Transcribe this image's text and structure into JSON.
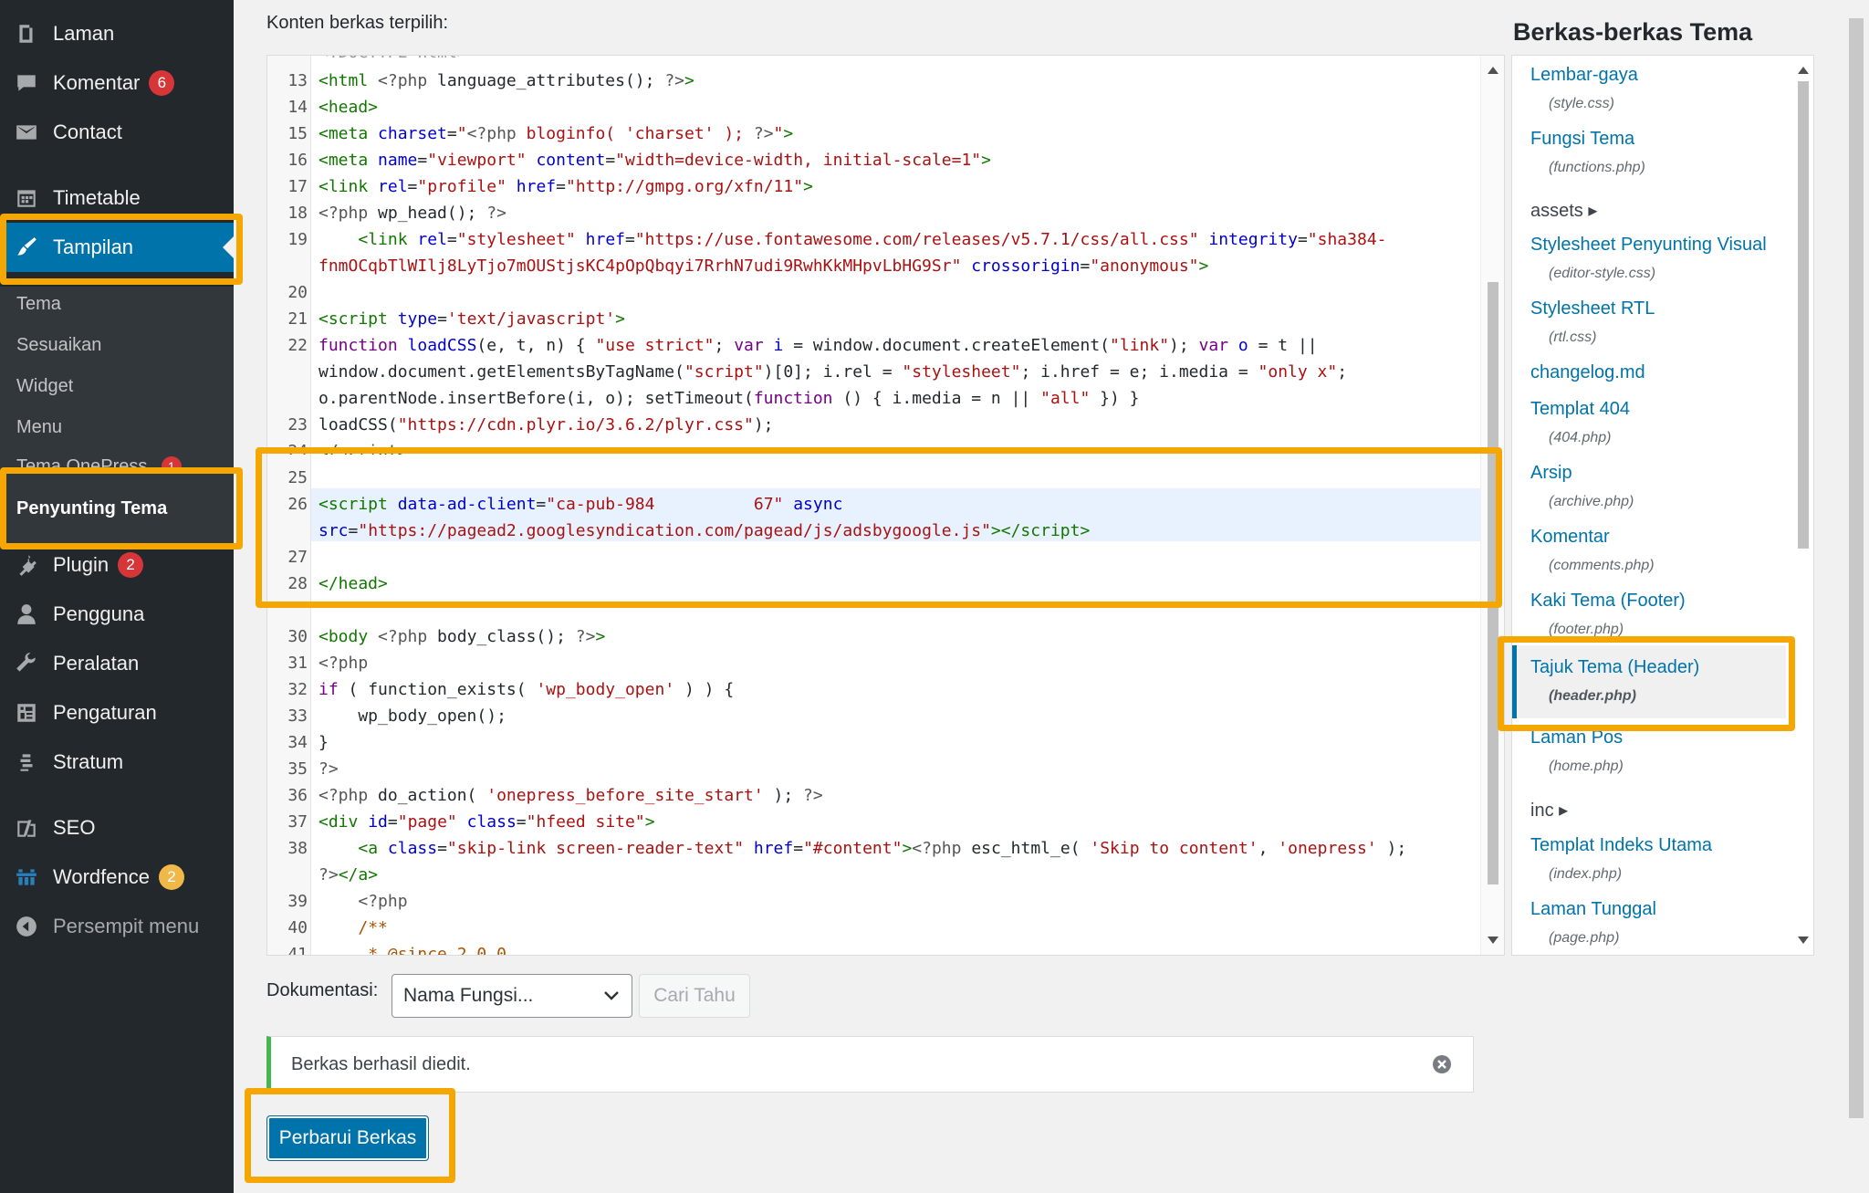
{
  "sidebar": {
    "items": [
      {
        "label": "Laman",
        "icon": "pages-icon"
      },
      {
        "label": "Komentar",
        "badge": "6",
        "icon": "comments-icon"
      },
      {
        "label": "Contact",
        "icon": "mail-icon"
      },
      {
        "label": "Timetable",
        "icon": "calendar-icon"
      },
      {
        "label": "Tampilan",
        "icon": "appearance-brush-icon"
      },
      {
        "label": "Plugin",
        "badge": "2",
        "icon": "plugin-icon"
      },
      {
        "label": "Pengguna",
        "icon": "users-icon"
      },
      {
        "label": "Peralatan",
        "icon": "tools-wrench-icon"
      },
      {
        "label": "Pengaturan",
        "icon": "settings-icon"
      },
      {
        "label": "Stratum",
        "icon": "stratum-icon"
      },
      {
        "label": "SEO",
        "icon": "yoast-seo-icon"
      },
      {
        "label": "Wordfence",
        "badge": "2",
        "icon": "wordfence-icon"
      },
      {
        "label": "Persempit menu",
        "icon": "collapse-arrow-icon"
      }
    ],
    "submenu": [
      {
        "label": "Tema"
      },
      {
        "label": "Sesuaikan"
      },
      {
        "label": "Widget"
      },
      {
        "label": "Menu"
      },
      {
        "label": "Tema OnePress",
        "badge": "1"
      },
      {
        "label": "Penyunting Tema"
      }
    ]
  },
  "editor": {
    "label": "Konten berkas terpilih:",
    "lines": [
      {
        "n": "13"
      },
      {
        "n": "14"
      },
      {
        "n": "15"
      },
      {
        "n": "16"
      },
      {
        "n": "17"
      },
      {
        "n": "18"
      },
      {
        "n": "19"
      },
      {
        "n": "20"
      },
      {
        "n": "21"
      },
      {
        "n": "22"
      },
      {
        "n": "23"
      },
      {
        "n": "24"
      },
      {
        "n": "25"
      },
      {
        "n": "26"
      },
      {
        "n": "27"
      },
      {
        "n": "28"
      },
      {
        "n": "30"
      },
      {
        "n": "31"
      },
      {
        "n": "32"
      },
      {
        "n": "33"
      },
      {
        "n": "34"
      },
      {
        "n": "35"
      },
      {
        "n": "36"
      },
      {
        "n": "37"
      },
      {
        "n": "38"
      },
      {
        "n": "39"
      },
      {
        "n": "40"
      },
      {
        "n": "41"
      }
    ]
  },
  "files": {
    "title": "Berkas-berkas Tema",
    "entries": [
      {
        "label": "Lembar-gaya",
        "file": "(style.css)"
      },
      {
        "label": "Fungsi Tema",
        "file": "(functions.php)"
      },
      {
        "label": "assets ▸"
      },
      {
        "label": "Stylesheet Penyunting Visual",
        "file": "(editor-style.css)"
      },
      {
        "label": "Stylesheet RTL",
        "file": "(rtl.css)"
      },
      {
        "label": "changelog.md"
      },
      {
        "label": "Templat 404",
        "file": "(404.php)"
      },
      {
        "label": "Arsip",
        "file": "(archive.php)"
      },
      {
        "label": "Komentar",
        "file": "(comments.php)"
      },
      {
        "label": "Kaki Tema (Footer)",
        "file": "(footer.php)"
      },
      {
        "label": "Tajuk Tema (Header)",
        "file": "(header.php)"
      },
      {
        "label": "Laman Pos",
        "file": "(home.php)"
      },
      {
        "label": "inc ▸"
      },
      {
        "label": "Templat Indeks Utama",
        "file": "(index.php)"
      },
      {
        "label": "Laman Tunggal",
        "file": "(page.php)"
      }
    ]
  },
  "documentation": {
    "label": "Dokumentasi:",
    "select_value": "Nama Fungsi...",
    "lookup_label": "Cari Tahu"
  },
  "notice": {
    "text": "Berkas berhasil diedit."
  },
  "update_button": {
    "label": "Perbarui Berkas"
  },
  "colors": {
    "highlight": "#f5a700",
    "wp_blue": "#0073aa",
    "sidebar": "#23282d"
  }
}
